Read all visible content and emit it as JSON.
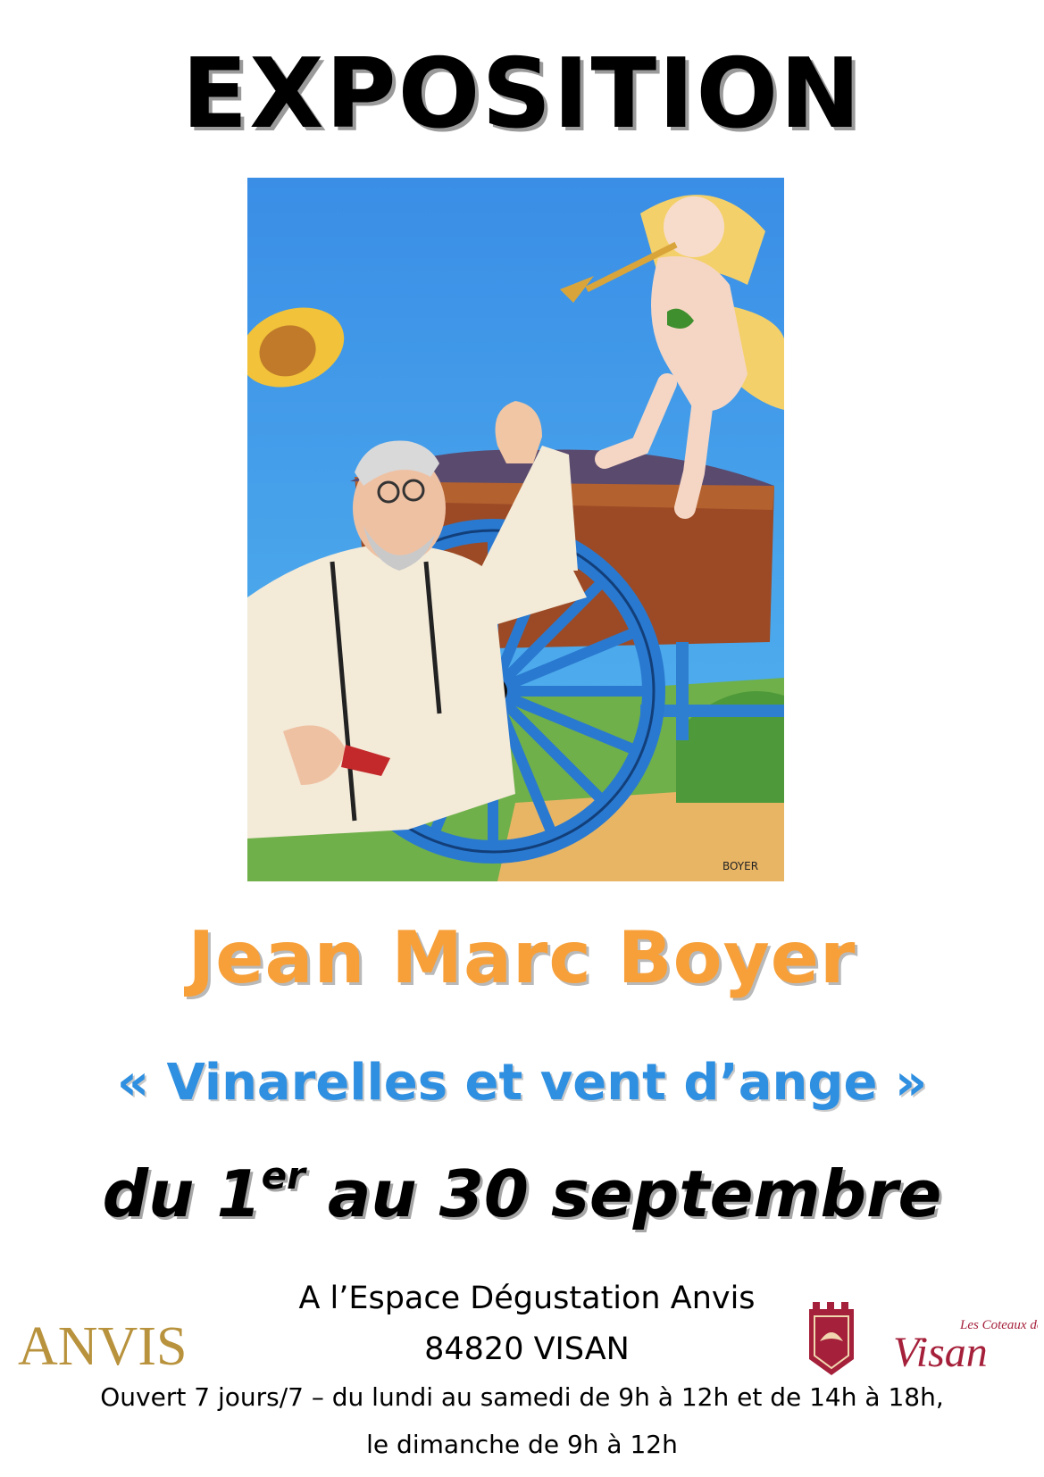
{
  "poster": {
    "title": "EXPOSITION",
    "artist": "Jean Marc Boyer",
    "exhibition_title": "« Vinarelles et vent d’ange »",
    "dates": {
      "prefix": "du 1",
      "sup": "er",
      "suffix": " au 30 septembre"
    },
    "venue": "A l’Espace Dégustation Anvis",
    "city": "84820 VISAN",
    "hours_line1": "Ouvert 7 jours/7 – du lundi au samedi de 9h à 12h et de 14h à 18h,",
    "hours_line2": "le dimanche de 9h à 12h"
  },
  "painting": {
    "signature": "BOYER"
  },
  "logos": {
    "anvis": "ANVIS",
    "coteaux_small": "Les Coteaux de",
    "coteaux_large": "Visan"
  },
  "colors": {
    "artist": "#f7a03a",
    "subtitle": "#2f8fe0",
    "anvis_gold": "#b8923c",
    "coteaux_red": "#a5203a"
  }
}
